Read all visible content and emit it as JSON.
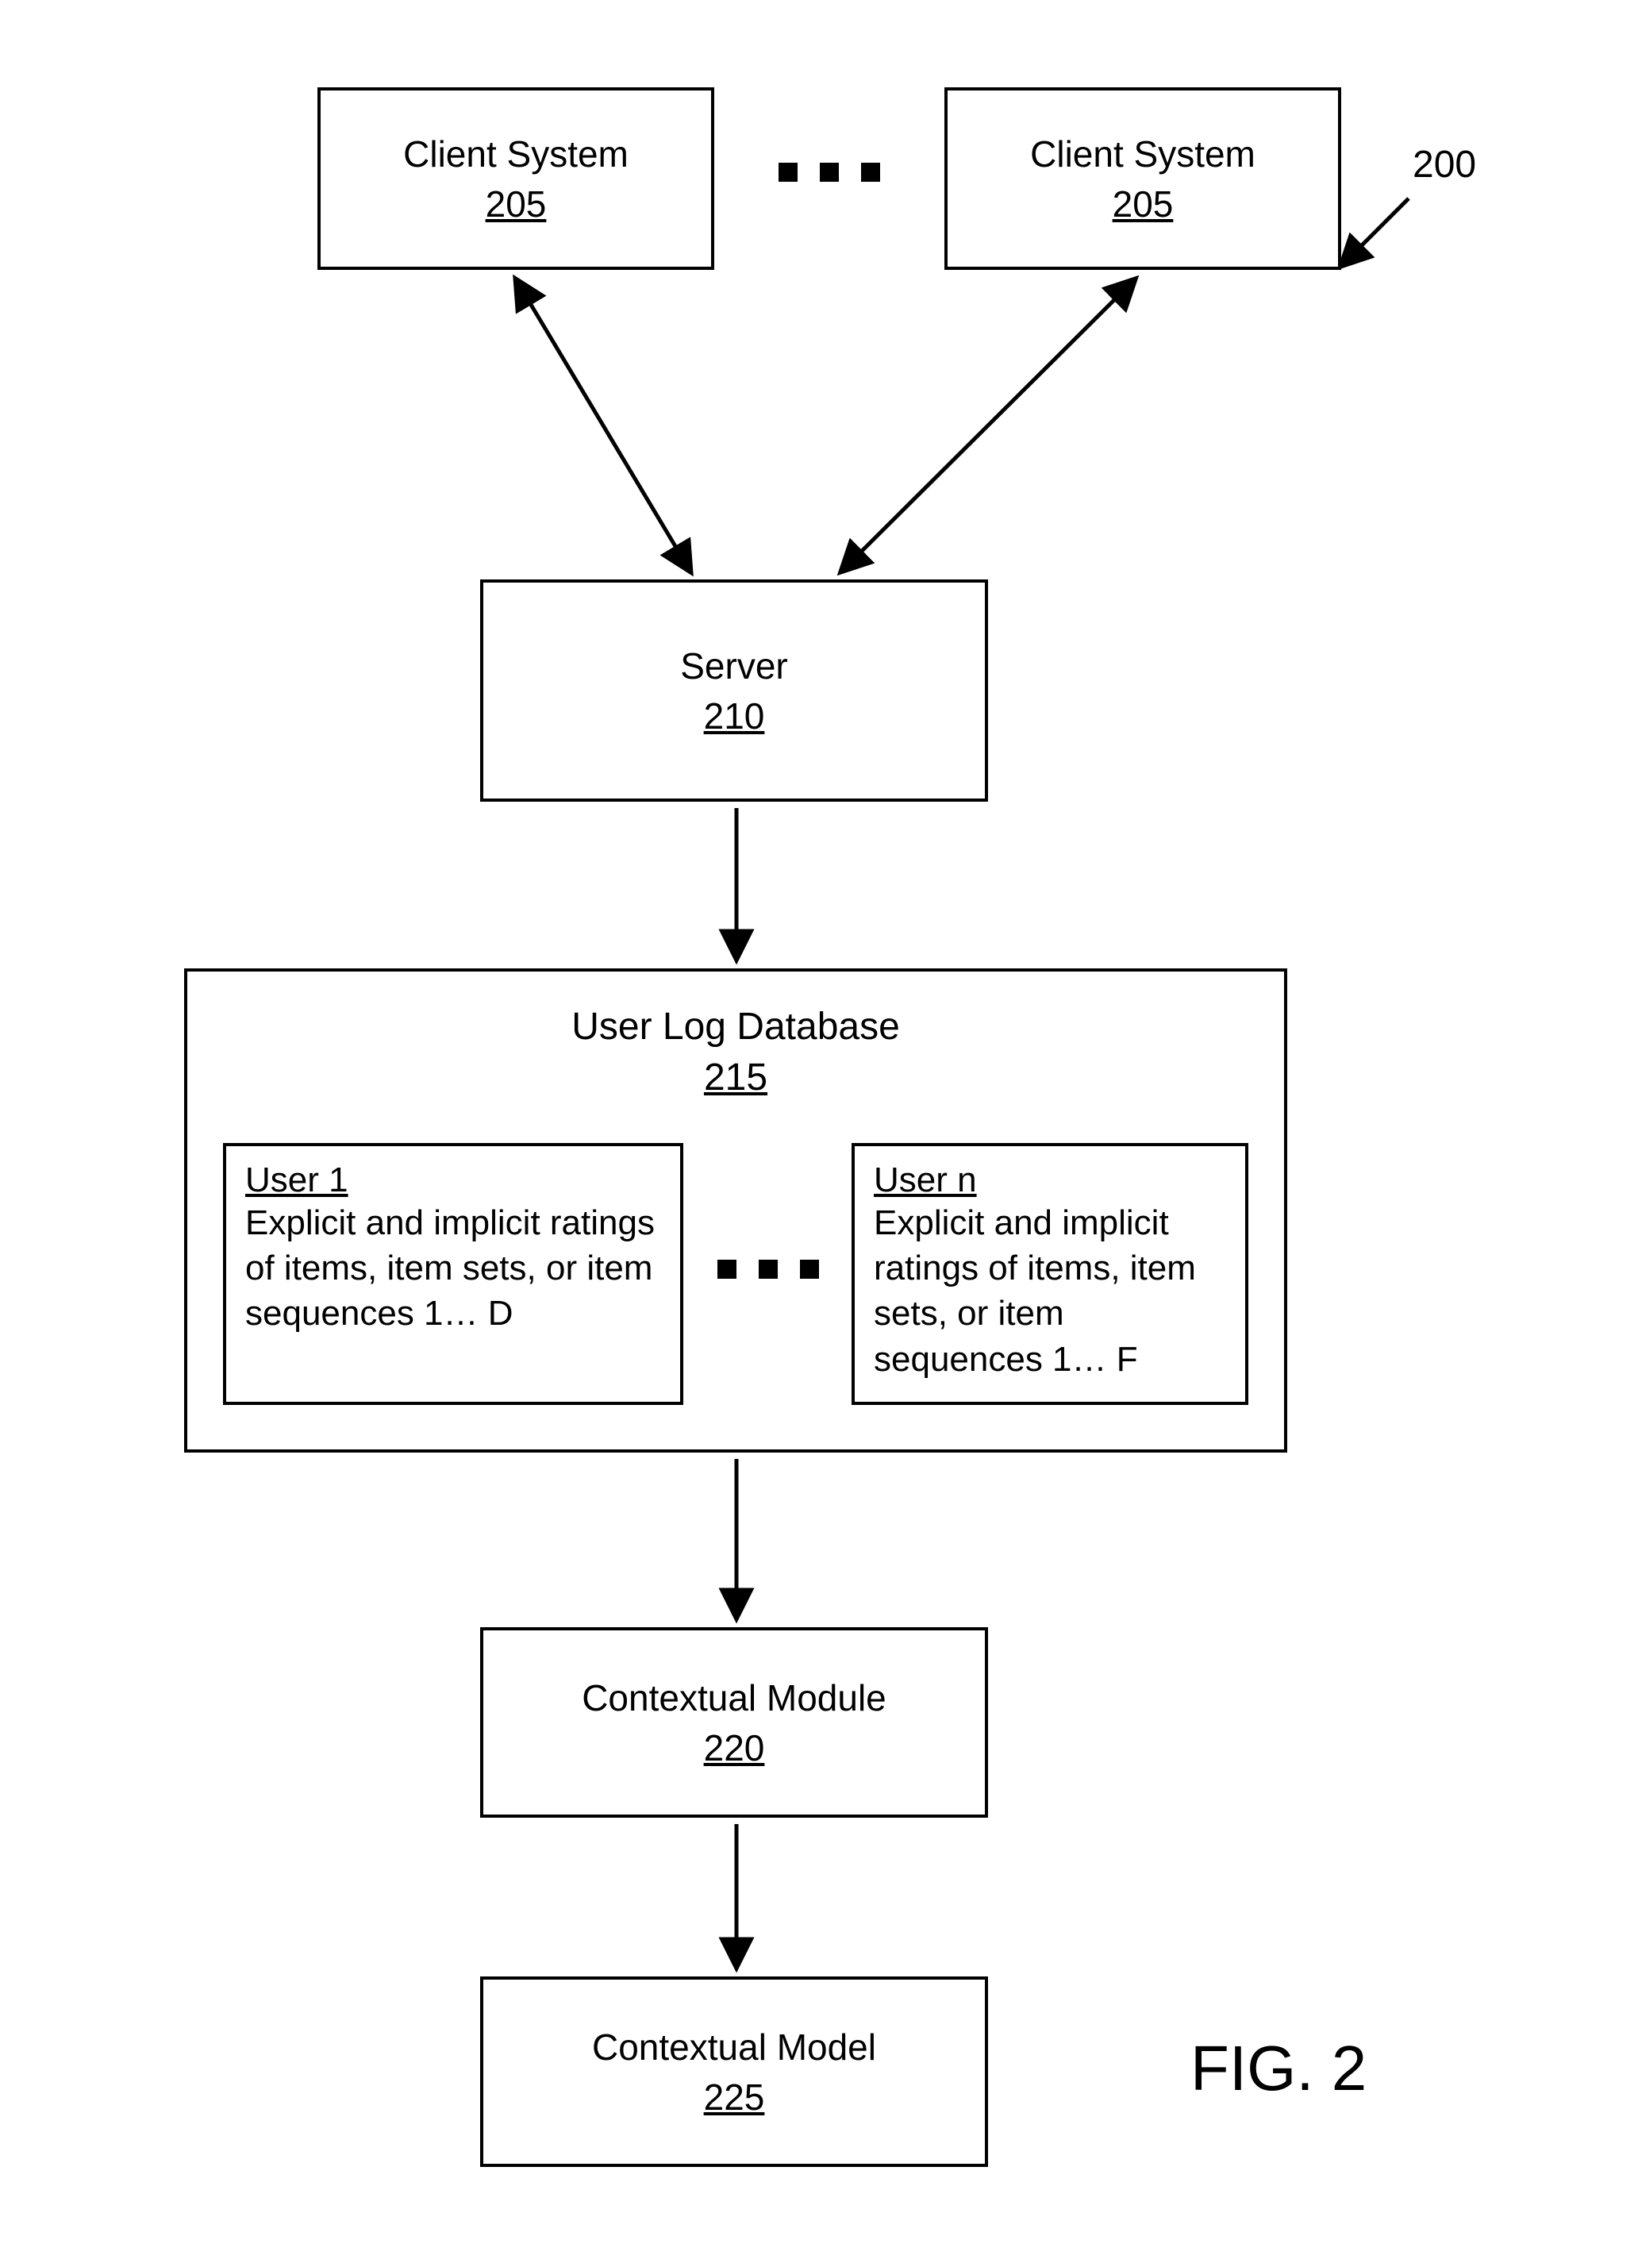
{
  "figure": {
    "label": "FIG. 2",
    "ref": "200"
  },
  "blocks": {
    "client_a": {
      "title": "Client System",
      "ref": "205"
    },
    "client_b": {
      "title": "Client System",
      "ref": "205"
    },
    "server": {
      "title": "Server",
      "ref": "210"
    },
    "db": {
      "title": "User Log Database",
      "ref": "215"
    },
    "user1": {
      "title": "User 1",
      "desc": "Explicit and implicit ratings of items, item sets, or item sequences 1… D"
    },
    "usern": {
      "title": "User n",
      "desc": "Explicit and implicit ratings of items, item sets, or item sequences 1… F"
    },
    "module": {
      "title": "Contextual Module",
      "ref": "220"
    },
    "model": {
      "title": "Contextual Model",
      "ref": "225"
    }
  }
}
